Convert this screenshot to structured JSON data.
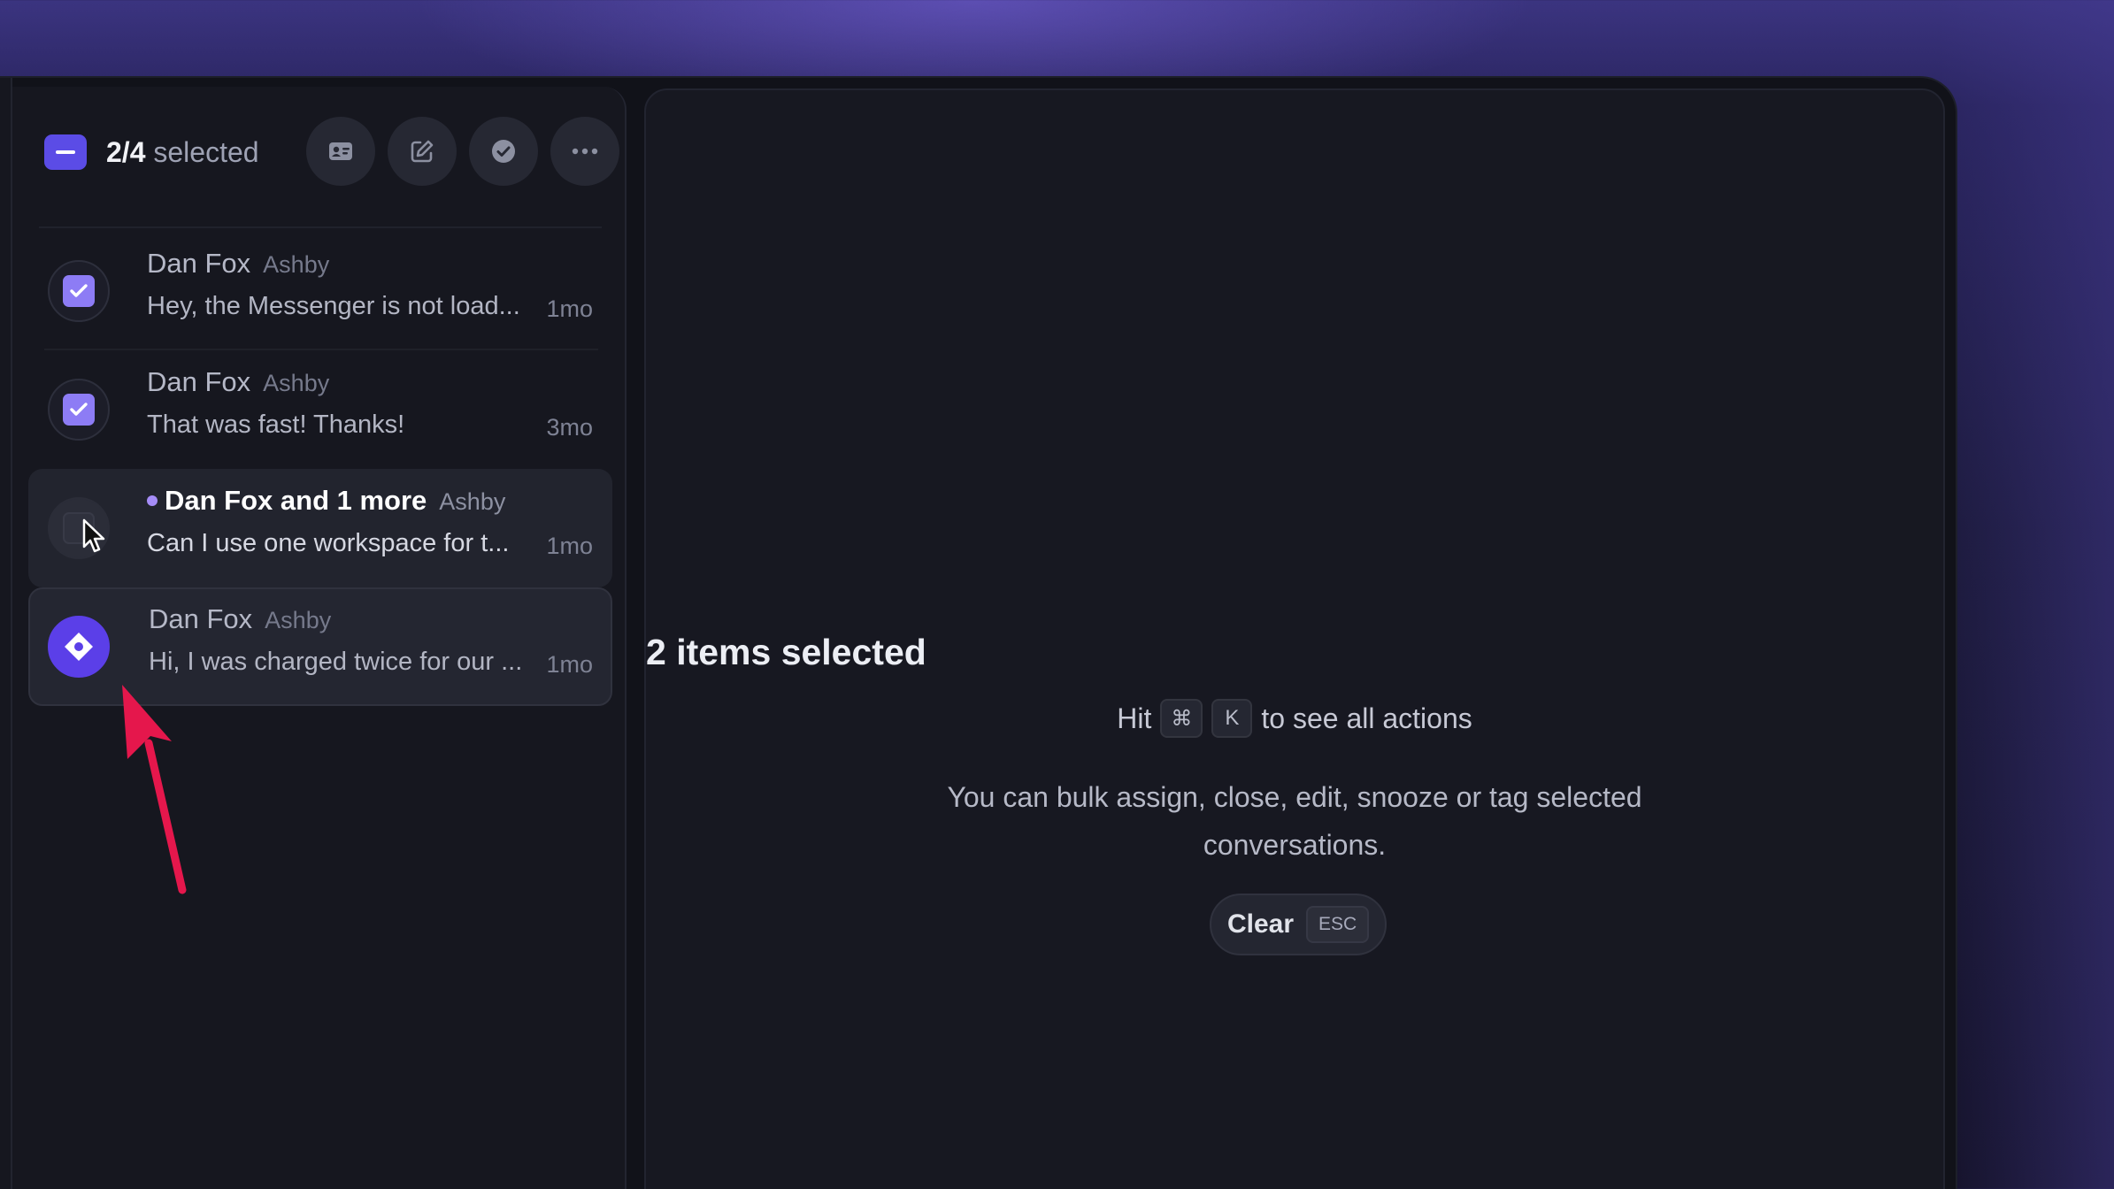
{
  "header": {
    "count": "2/4",
    "selected_label": "selected",
    "actions": [
      {
        "icon": "contact-card-icon"
      },
      {
        "icon": "edit-icon"
      },
      {
        "icon": "check-circle-icon"
      },
      {
        "icon": "more-icon"
      }
    ]
  },
  "conversations": [
    {
      "name": "Dan Fox",
      "company": "Ashby",
      "preview": "Hey, the Messenger is not load...",
      "time": "1mo",
      "state": "checked"
    },
    {
      "name": "Dan Fox",
      "company": "Ashby",
      "preview": "That was fast! Thanks!",
      "time": "3mo",
      "state": "checked"
    },
    {
      "name": "Dan Fox and 1 more",
      "company": "Ashby",
      "preview": "Can I use one workspace for t...",
      "time": "1mo",
      "state": "unchecked-hover",
      "unread": true
    },
    {
      "name": "Dan Fox",
      "company": "Ashby",
      "preview": "Hi, I was charged twice for our ...",
      "time": "1mo",
      "state": "brand-avatar"
    }
  ],
  "detail": {
    "title": "2 items selected",
    "hint_prefix": "Hit",
    "key_cmd": "⌘",
    "key_k": "K",
    "hint_suffix": "to see all actions",
    "description": "You can bulk assign, close, edit, snooze or tag selected conversations.",
    "clear_label": "Clear",
    "clear_key": "ESC"
  },
  "colors": {
    "accent": "#5b4ce6",
    "checkbox": "#8d7cf5",
    "annotation_arrow": "#e5174c"
  }
}
